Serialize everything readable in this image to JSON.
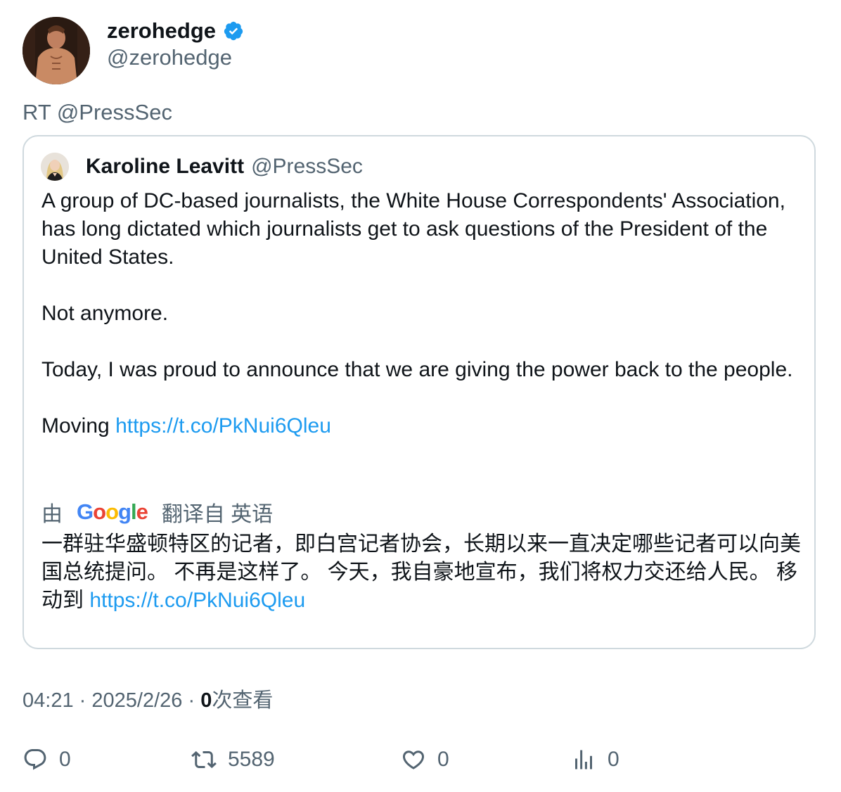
{
  "author": {
    "display_name": "zerohedge",
    "handle": "@zerohedge",
    "verified": true,
    "verified_color": "#1d9bf0"
  },
  "retweet_label": "RT @PressSec",
  "quoted": {
    "display_name": "Karoline Leavitt",
    "handle": "@PressSec",
    "paragraph1": "A group of DC-based journalists, the White House Correspondents' Association, has long dictated which journalists get to ask questions of the President of the United States.",
    "paragraph2": "Not anymore.",
    "paragraph3": "Today, I was proud to announce that we are giving the power back to the people.",
    "moving_prefix": "Moving",
    "link": "https://t.co/PkNui6Qleu"
  },
  "translation": {
    "by_label": "由",
    "google_label": "Google",
    "from_label": "翻译自 英语",
    "text": "一群驻华盛顿特区的记者，即白宫记者协会，长期以来一直决定哪些记者可以向美国总统提问。 不再是这样了。 今天，我自豪地宣布，我们将权力交还给人民。 移动到",
    "link": "https://t.co/PkNui6Qleu"
  },
  "meta": {
    "time": "04:21",
    "separator1": "·",
    "date": "2025/2/26",
    "separator2": "·",
    "views_count": "0",
    "views_label": "次查看"
  },
  "actions": {
    "replies": "0",
    "retweets": "5589",
    "likes": "0",
    "views": "0"
  },
  "colors": {
    "text": "#0f1419",
    "secondary": "#536471",
    "link": "#1d9bf0",
    "border": "#cfd9de"
  }
}
